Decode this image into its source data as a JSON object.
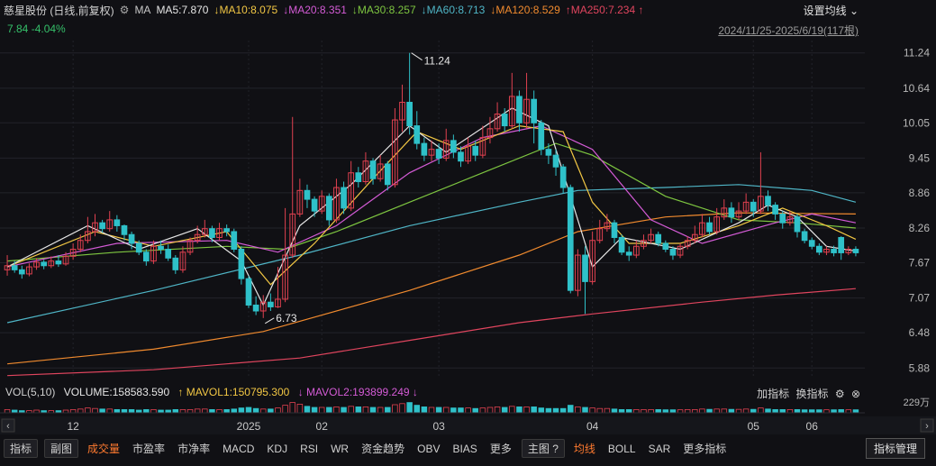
{
  "header": {
    "title": "慈星股份 (日线,前复权)",
    "ma_label": "MA",
    "ma_values": [
      {
        "label": "MA5:7.870",
        "color": "#e6e6e6"
      },
      {
        "label": "↓MA10:8.075",
        "color": "#f2c744"
      },
      {
        "label": "↓MA20:8.351",
        "color": "#d45bd6"
      },
      {
        "label": "↓MA30:8.257",
        "color": "#7dc540"
      },
      {
        "label": "↓MA60:8.713",
        "color": "#4fb5c6"
      },
      {
        "label": "↓MA120:8.529",
        "color": "#f08a2e"
      },
      {
        "label": "↑MA250:7.234 ↑",
        "color": "#e0455e"
      }
    ],
    "ma_setting": "设置均线 ⌄",
    "last_price": "7.84",
    "change_pct": "-4.04%",
    "date_range": "2024/11/25-2025/6/19(117根)"
  },
  "price_axis": {
    "ticks": [
      "11.24",
      "10.64",
      "10.05",
      "9.45",
      "8.86",
      "8.26",
      "7.67",
      "7.07",
      "6.48",
      "5.88"
    ]
  },
  "time_axis": {
    "labels": [
      "12",
      "2025",
      "02",
      "03",
      "04",
      "05",
      "06"
    ]
  },
  "annotations": {
    "high_label": "11.24",
    "low_label": "6.73"
  },
  "volume": {
    "title": "VOL(5,10)",
    "volume": "VOLUME:158583.590",
    "mavol1": "↑ MAVOL1:150795.300",
    "mavol2": "↓ MAVOL2:193899.249 ↓",
    "add_indicator": "加指标",
    "switch_indicator": "换指标",
    "axis_label": "229万"
  },
  "bottom_tabs": {
    "indicators": "指标",
    "subchart": "副图",
    "items": [
      "成交量",
      "市盈率",
      "市净率",
      "MACD",
      "KDJ",
      "RSI",
      "WR",
      "资金趋势",
      "OBV",
      "BIAS",
      "更多"
    ],
    "main_chart": "主图",
    "main_items": [
      "均线",
      "BOLL",
      "SAR",
      "更多指标"
    ],
    "manage": "指标管理"
  },
  "colors": {
    "up": "#e04150",
    "down": "#2fc1c9",
    "bg": "#101014",
    "grid": "#22232a"
  },
  "chart_data": {
    "type": "candlestick",
    "series_name": "",
    "y_ticks": [
      11.24,
      10.64,
      10.05,
      9.45,
      8.86,
      8.26,
      7.67,
      7.07,
      6.48,
      5.88
    ],
    "ylim": [
      5.7,
      11.45
    ],
    "candles": [
      [
        7.55,
        7.62,
        7.8,
        7.45
      ],
      [
        7.62,
        7.55,
        7.7,
        7.5
      ],
      [
        7.55,
        7.48,
        7.62,
        7.4
      ],
      [
        7.48,
        7.6,
        7.66,
        7.44
      ],
      [
        7.6,
        7.68,
        7.75,
        7.55
      ],
      [
        7.68,
        7.62,
        7.72,
        7.56
      ],
      [
        7.62,
        7.7,
        7.78,
        7.58
      ],
      [
        7.7,
        7.65,
        7.8,
        7.6
      ],
      [
        7.65,
        7.78,
        7.85,
        7.62
      ],
      [
        7.78,
        7.9,
        8.0,
        7.72
      ],
      [
        7.9,
        8.05,
        8.15,
        7.85
      ],
      [
        8.05,
        8.2,
        8.45,
        8.0
      ],
      [
        8.2,
        8.35,
        8.5,
        8.12
      ],
      [
        8.35,
        8.25,
        8.4,
        8.18
      ],
      [
        8.25,
        8.4,
        8.55,
        8.2
      ],
      [
        8.4,
        8.3,
        8.48,
        8.2
      ],
      [
        8.3,
        8.15,
        8.32,
        8.05
      ],
      [
        8.15,
        8.0,
        8.2,
        7.9
      ],
      [
        8.0,
        7.85,
        8.05,
        7.8
      ],
      [
        7.85,
        7.7,
        7.9,
        7.62
      ],
      [
        7.7,
        7.95,
        8.05,
        7.65
      ],
      [
        7.95,
        7.9,
        8.05,
        7.82
      ],
      [
        7.9,
        7.75,
        7.98,
        7.7
      ],
      [
        7.75,
        7.55,
        7.8,
        7.48
      ],
      [
        7.55,
        7.85,
        7.95,
        7.5
      ],
      [
        7.85,
        8.05,
        8.1,
        7.8
      ],
      [
        8.05,
        8.15,
        8.3,
        8.0
      ],
      [
        8.15,
        8.25,
        8.4,
        8.1
      ],
      [
        8.25,
        8.1,
        8.3,
        8.02
      ],
      [
        8.1,
        8.25,
        8.35,
        8.05
      ],
      [
        8.25,
        8.2,
        8.32,
        8.12
      ],
      [
        8.2,
        7.9,
        8.25,
        7.85
      ],
      [
        7.9,
        7.4,
        7.95,
        7.3
      ],
      [
        7.4,
        6.95,
        7.45,
        6.9
      ],
      [
        6.95,
        6.85,
        7.1,
        6.78
      ],
      [
        6.85,
        7.0,
        7.12,
        6.73
      ],
      [
        7.0,
        6.92,
        7.15,
        6.85
      ],
      [
        6.92,
        7.05,
        7.6,
        6.9
      ],
      [
        7.05,
        7.8,
        8.6,
        7.0
      ],
      [
        7.8,
        8.5,
        10.15,
        7.75
      ],
      [
        8.5,
        8.9,
        9.1,
        8.45
      ],
      [
        8.9,
        8.75,
        9.0,
        8.6
      ],
      [
        8.75,
        8.55,
        8.8,
        8.45
      ],
      [
        8.55,
        8.8,
        8.9,
        8.5
      ],
      [
        8.8,
        8.4,
        8.85,
        8.3
      ],
      [
        8.4,
        8.95,
        9.1,
        8.35
      ],
      [
        8.95,
        8.6,
        9.05,
        8.5
      ],
      [
        8.6,
        9.2,
        9.4,
        8.55
      ],
      [
        9.2,
        9.05,
        9.3,
        8.95
      ],
      [
        9.05,
        9.4,
        9.55,
        9.0
      ],
      [
        9.4,
        9.1,
        9.45,
        9.0
      ],
      [
        9.1,
        9.35,
        9.5,
        9.05
      ],
      [
        9.35,
        9.0,
        9.4,
        8.9
      ],
      [
        9.0,
        10.1,
        10.3,
        8.95
      ],
      [
        10.1,
        10.4,
        10.7,
        9.9
      ],
      [
        10.4,
        10.0,
        11.24,
        9.85
      ],
      [
        10.0,
        9.7,
        10.25,
        9.6
      ],
      [
        9.7,
        9.5,
        9.8,
        9.4
      ],
      [
        9.5,
        9.6,
        9.75,
        9.4
      ],
      [
        9.6,
        9.45,
        9.7,
        9.35
      ],
      [
        9.45,
        9.75,
        9.95,
        9.4
      ],
      [
        9.75,
        9.55,
        9.85,
        9.45
      ],
      [
        9.55,
        9.4,
        9.65,
        9.3
      ],
      [
        9.4,
        9.65,
        9.8,
        9.35
      ],
      [
        9.65,
        9.5,
        9.75,
        9.4
      ],
      [
        9.5,
        9.8,
        10.0,
        9.45
      ],
      [
        9.8,
        9.95,
        10.15,
        9.7
      ],
      [
        9.95,
        10.2,
        10.4,
        9.9
      ],
      [
        10.2,
        10.0,
        10.3,
        9.9
      ],
      [
        10.0,
        10.5,
        10.9,
        9.95
      ],
      [
        10.5,
        10.05,
        10.6,
        9.9
      ],
      [
        10.05,
        10.45,
        10.9,
        9.95
      ],
      [
        10.45,
        10.05,
        10.6,
        9.7
      ],
      [
        10.05,
        9.6,
        10.1,
        9.5
      ],
      [
        9.6,
        9.5,
        9.7,
        9.35
      ],
      [
        9.5,
        9.3,
        9.6,
        9.15
      ],
      [
        9.3,
        8.95,
        9.35,
        8.85
      ],
      [
        8.95,
        7.2,
        9.0,
        7.15
      ],
      [
        7.2,
        7.8,
        7.9,
        7.1
      ],
      [
        7.8,
        7.35,
        7.95,
        6.8
      ],
      [
        7.35,
        8.05,
        8.2,
        7.3
      ],
      [
        8.05,
        8.25,
        8.4,
        8.0
      ],
      [
        8.25,
        8.35,
        8.5,
        8.2
      ],
      [
        8.35,
        8.1,
        8.4,
        8.0
      ],
      [
        8.1,
        7.85,
        8.15,
        7.8
      ],
      [
        7.85,
        7.8,
        7.95,
        7.7
      ],
      [
        7.8,
        7.95,
        8.05,
        7.75
      ],
      [
        7.95,
        8.05,
        8.15,
        7.9
      ],
      [
        8.05,
        8.15,
        8.25,
        8.0
      ],
      [
        8.15,
        8.0,
        8.2,
        7.95
      ],
      [
        8.0,
        7.9,
        8.05,
        7.85
      ],
      [
        7.9,
        7.8,
        7.95,
        7.72
      ],
      [
        7.8,
        7.95,
        8.0,
        7.75
      ],
      [
        7.95,
        8.05,
        8.12,
        7.9
      ],
      [
        8.05,
        8.15,
        8.3,
        8.0
      ],
      [
        8.15,
        8.35,
        8.5,
        8.1
      ],
      [
        8.35,
        8.2,
        8.45,
        8.15
      ],
      [
        8.2,
        8.45,
        8.6,
        8.15
      ],
      [
        8.45,
        8.6,
        8.75,
        8.4
      ],
      [
        8.6,
        8.45,
        8.7,
        8.35
      ],
      [
        8.45,
        8.55,
        8.7,
        8.4
      ],
      [
        8.55,
        8.7,
        8.85,
        8.5
      ],
      [
        8.7,
        8.55,
        8.75,
        8.45
      ],
      [
        8.55,
        8.8,
        9.55,
        8.5
      ],
      [
        8.8,
        8.65,
        8.9,
        8.55
      ],
      [
        8.65,
        8.5,
        8.7,
        8.4
      ],
      [
        8.5,
        8.35,
        8.55,
        8.25
      ],
      [
        8.35,
        8.45,
        8.55,
        8.3
      ],
      [
        8.45,
        8.2,
        8.5,
        8.1
      ],
      [
        8.2,
        8.05,
        8.25,
        8.0
      ],
      [
        8.05,
        7.95,
        8.1,
        7.9
      ],
      [
        7.95,
        7.85,
        8.0,
        7.8
      ],
      [
        7.85,
        7.9,
        7.95,
        7.8
      ],
      [
        7.9,
        7.84,
        7.96,
        7.78
      ],
      [
        8.1,
        7.84,
        8.12,
        7.72
      ],
      [
        7.84,
        7.9,
        7.95,
        7.8
      ],
      [
        7.9,
        7.84,
        7.95,
        7.78
      ]
    ],
    "volume_ratio": [
      0.3,
      0.25,
      0.2,
      0.2,
      0.25,
      0.2,
      0.2,
      0.2,
      0.25,
      0.3,
      0.35,
      0.45,
      0.4,
      0.35,
      0.35,
      0.3,
      0.3,
      0.3,
      0.25,
      0.3,
      0.3,
      0.25,
      0.25,
      0.3,
      0.3,
      0.3,
      0.35,
      0.35,
      0.3,
      0.3,
      0.3,
      0.35,
      0.45,
      0.5,
      0.4,
      0.35,
      0.35,
      0.45,
      0.7,
      0.95,
      0.8,
      0.6,
      0.5,
      0.5,
      0.5,
      0.55,
      0.5,
      0.6,
      0.55,
      0.55,
      0.5,
      0.5,
      0.5,
      0.75,
      0.85,
      0.95,
      0.7,
      0.55,
      0.5,
      0.5,
      0.5,
      0.45,
      0.45,
      0.45,
      0.4,
      0.45,
      0.5,
      0.55,
      0.5,
      0.6,
      0.55,
      0.55,
      0.55,
      0.45,
      0.4,
      0.4,
      0.4,
      0.7,
      0.55,
      0.5,
      0.45,
      0.4,
      0.4,
      0.35,
      0.3,
      0.3,
      0.3,
      0.3,
      0.3,
      0.3,
      0.28,
      0.28,
      0.28,
      0.3,
      0.3,
      0.35,
      0.32,
      0.35,
      0.35,
      0.32,
      0.32,
      0.35,
      0.32,
      0.45,
      0.35,
      0.3,
      0.3,
      0.3,
      0.3,
      0.28,
      0.28,
      0.28,
      0.28,
      0.28,
      0.3,
      0.28,
      0.28
    ],
    "ma_lines": [
      {
        "name": "MA60",
        "color": "#4fb5c6",
        "points": [
          [
            0,
            6.65
          ],
          [
            20,
            7.2
          ],
          [
            40,
            7.8
          ],
          [
            55,
            8.3
          ],
          [
            70,
            8.7
          ],
          [
            78,
            8.9
          ],
          [
            90,
            8.95
          ],
          [
            100,
            9.0
          ],
          [
            110,
            8.9
          ],
          [
            116,
            8.7
          ]
        ]
      },
      {
        "name": "MA120",
        "color": "#f08a2e",
        "points": [
          [
            0,
            5.95
          ],
          [
            20,
            6.2
          ],
          [
            35,
            6.5
          ],
          [
            55,
            7.2
          ],
          [
            70,
            7.8
          ],
          [
            78,
            8.2
          ],
          [
            90,
            8.45
          ],
          [
            100,
            8.52
          ],
          [
            116,
            8.5
          ]
        ]
      },
      {
        "name": "MA250",
        "color": "#e0455e",
        "points": [
          [
            0,
            5.75
          ],
          [
            20,
            5.85
          ],
          [
            40,
            6.05
          ],
          [
            55,
            6.35
          ],
          [
            70,
            6.65
          ],
          [
            80,
            6.8
          ],
          [
            95,
            7.0
          ],
          [
            105,
            7.12
          ],
          [
            116,
            7.23
          ]
        ]
      },
      {
        "name": "MA30",
        "color": "#7dc540",
        "points": [
          [
            0,
            7.7
          ],
          [
            15,
            7.85
          ],
          [
            30,
            7.95
          ],
          [
            38,
            7.9
          ],
          [
            45,
            8.2
          ],
          [
            55,
            8.7
          ],
          [
            65,
            9.2
          ],
          [
            75,
            9.7
          ],
          [
            80,
            9.5
          ],
          [
            90,
            8.8
          ],
          [
            100,
            8.4
          ],
          [
            108,
            8.35
          ],
          [
            116,
            8.26
          ]
        ]
      },
      {
        "name": "MA20",
        "color": "#d45bd6",
        "points": [
          [
            0,
            7.6
          ],
          [
            15,
            8.0
          ],
          [
            30,
            8.05
          ],
          [
            37,
            7.85
          ],
          [
            45,
            8.3
          ],
          [
            55,
            9.2
          ],
          [
            65,
            9.8
          ],
          [
            73,
            10.0
          ],
          [
            80,
            9.6
          ],
          [
            88,
            8.4
          ],
          [
            95,
            8.0
          ],
          [
            105,
            8.35
          ],
          [
            110,
            8.5
          ],
          [
            116,
            8.35
          ]
        ]
      },
      {
        "name": "MA10",
        "color": "#f2c744",
        "points": [
          [
            0,
            7.6
          ],
          [
            12,
            8.2
          ],
          [
            20,
            7.95
          ],
          [
            30,
            8.2
          ],
          [
            36,
            7.3
          ],
          [
            42,
            8.0
          ],
          [
            50,
            9.1
          ],
          [
            56,
            9.9
          ],
          [
            62,
            9.6
          ],
          [
            70,
            10.0
          ],
          [
            76,
            9.9
          ],
          [
            80,
            8.7
          ],
          [
            85,
            8.0
          ],
          [
            92,
            8.0
          ],
          [
            100,
            8.3
          ],
          [
            106,
            8.6
          ],
          [
            112,
            8.3
          ],
          [
            116,
            8.07
          ]
        ]
      },
      {
        "name": "MA5",
        "color": "#e6e6e6",
        "points": [
          [
            0,
            7.6
          ],
          [
            11,
            8.3
          ],
          [
            18,
            7.9
          ],
          [
            26,
            8.25
          ],
          [
            32,
            7.7
          ],
          [
            35,
            6.95
          ],
          [
            40,
            8.3
          ],
          [
            47,
            9.0
          ],
          [
            55,
            10.0
          ],
          [
            60,
            9.55
          ],
          [
            69,
            10.3
          ],
          [
            74,
            10.0
          ],
          [
            78,
            8.4
          ],
          [
            80,
            7.6
          ],
          [
            84,
            8.1
          ],
          [
            92,
            7.9
          ],
          [
            100,
            8.35
          ],
          [
            104,
            8.65
          ],
          [
            108,
            8.45
          ],
          [
            112,
            7.95
          ],
          [
            116,
            7.87
          ]
        ]
      }
    ]
  }
}
